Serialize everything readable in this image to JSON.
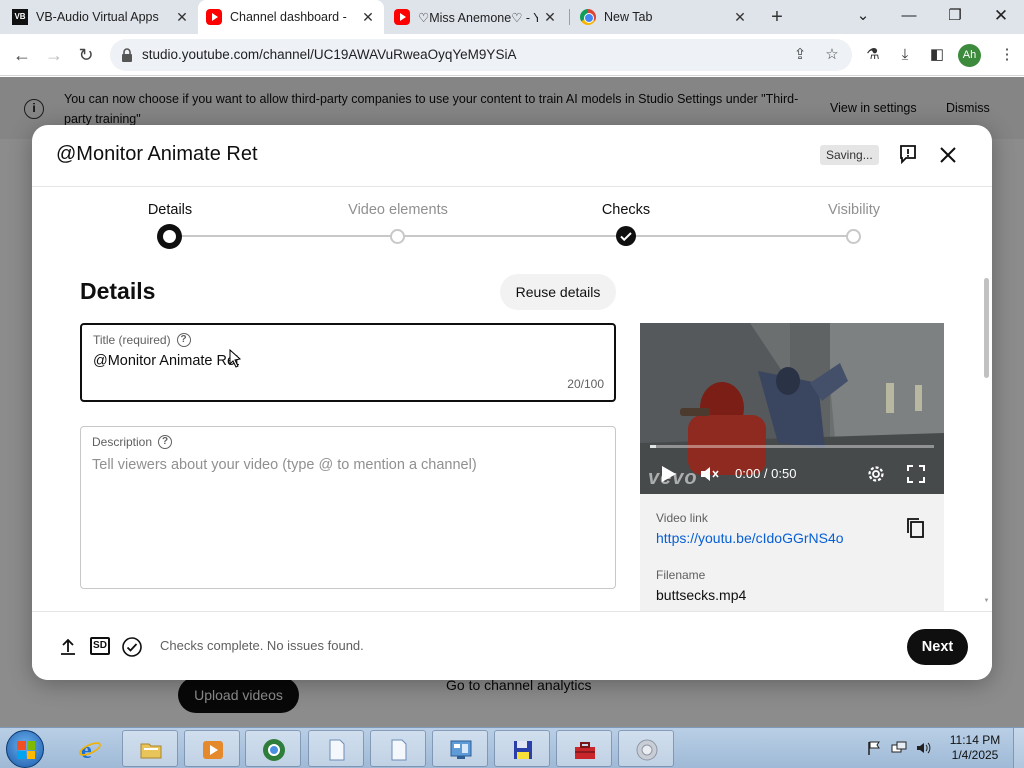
{
  "browser": {
    "tabs": [
      {
        "title": "VB-Audio Virtual Apps",
        "icon": "vb-audio-icon",
        "active": false
      },
      {
        "title": "Channel dashboard - ",
        "icon": "youtube-icon",
        "active": true
      },
      {
        "title": "♡Miss Anemone♡ - Yo",
        "icon": "youtube-icon",
        "active": false
      },
      {
        "title": "New Tab",
        "icon": "chrome-icon",
        "active": false
      }
    ],
    "new_tab_symbol": "+",
    "url": "studio.youtube.com/channel/UC19AWAVuRweaOyqYeM9YSiA",
    "profile_initials": "Ah"
  },
  "banner": {
    "message": "You can now choose if you want to allow third-party companies to use your content to train AI models in Studio Settings under \"Third-party training\"",
    "view_settings": "View in settings",
    "dismiss": "Dismiss"
  },
  "background_page": {
    "upload_button": "Upload videos",
    "analytics_link": "Go to channel analytics"
  },
  "dialog": {
    "title": "@Monitor Animate Ret",
    "saving_badge": "Saving...",
    "steps": [
      {
        "label": "Details",
        "state": "current"
      },
      {
        "label": "Video elements",
        "state": "pending"
      },
      {
        "label": "Checks",
        "state": "complete"
      },
      {
        "label": "Visibility",
        "state": "pending"
      }
    ],
    "section_title": "Details",
    "reuse_button": "Reuse details",
    "title_field": {
      "label": "Title (required)",
      "value": "@Monitor Animate Ret",
      "counter": "20/100"
    },
    "description_field": {
      "label": "Description",
      "placeholder": "Tell viewers about your video (type @ to mention a channel)"
    },
    "video": {
      "time": "0:00 / 0:50",
      "progress": 0.02,
      "watermark": "vevo",
      "link_label": "Video link",
      "link": "https://youtu.be/cIdoGGrNS4o",
      "filename_label": "Filename",
      "filename": "buttsecks.mp4"
    },
    "footer": {
      "checks_status": "Checks complete. No issues found.",
      "next_button": "Next"
    }
  },
  "taskbar": {
    "time": "11:14 PM",
    "date": "1/4/2025"
  },
  "colors": {
    "youtube_red": "#ff0000",
    "link_blue": "#065fd4",
    "primary_dark": "#0f0f0f",
    "taskbar": "#b9cfe6"
  }
}
